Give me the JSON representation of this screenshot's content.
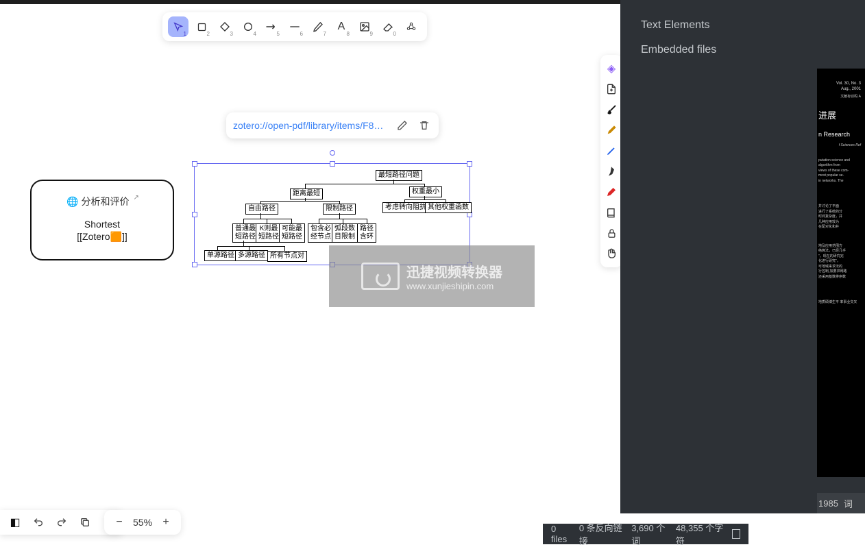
{
  "toolbar": {
    "items": [
      {
        "name": "selection-tool",
        "sub": "1"
      },
      {
        "name": "rectangle-tool",
        "sub": "2"
      },
      {
        "name": "diamond-tool",
        "sub": "3"
      },
      {
        "name": "ellipse-tool",
        "sub": "4"
      },
      {
        "name": "arrow-tool",
        "sub": "5"
      },
      {
        "name": "line-tool",
        "sub": "6"
      },
      {
        "name": "draw-tool",
        "sub": "7"
      },
      {
        "name": "text-tool",
        "sub": "8"
      },
      {
        "name": "image-tool",
        "sub": "9"
      },
      {
        "name": "eraser-tool",
        "sub": "0"
      },
      {
        "name": "shapes-tool",
        "sub": ""
      }
    ]
  },
  "vtoolbar": {
    "items": [
      {
        "name": "obsidian-icon",
        "color": "#8b5cf6"
      },
      {
        "name": "insert-file-icon",
        "color": "#333"
      },
      {
        "name": "brush-icon",
        "color": "#111"
      },
      {
        "name": "highlighter-icon",
        "color": "#ca8a04"
      },
      {
        "name": "pen-icon",
        "color": "#2563eb"
      },
      {
        "name": "nib-icon",
        "color": "#111"
      },
      {
        "name": "marker-icon",
        "color": "#dc2626"
      },
      {
        "name": "book-icon",
        "color": "#333"
      },
      {
        "name": "lock-icon",
        "color": "#333"
      },
      {
        "name": "hand-icon",
        "color": "#333"
      }
    ]
  },
  "link_popup": {
    "url": "zotero://open-pdf/library/items/F8…"
  },
  "card": {
    "title": "分析和评价",
    "line1": "Shortest",
    "line2_pre": "[[Zotero",
    "line2_post": "]]"
  },
  "diagram": {
    "root": "最短路径问题",
    "l2a": "距离最短",
    "l2b": "权重最小",
    "l3a": "自由路径",
    "l3b": "限制路径",
    "l3c": "考虑转向阻抗",
    "l3d": "其他权重函数",
    "l4a": "普通最\n短路径",
    "l4b": "K则最\n短路径",
    "l4c": "可能最\n短路径",
    "l4d": "包含必\n经节点",
    "l4e": "弧段数\n目限制",
    "l4f": "路径\n含环",
    "l5a": "单源路径",
    "l5b": "多源路径",
    "l5c": "所有节点对"
  },
  "watermark": {
    "line1": "迅捷视频转换器",
    "line2": "www.xunjieshipin.com"
  },
  "bottom": {
    "zoom": "55%"
  },
  "sidebar": {
    "item1": "Text Elements",
    "item2": "Embedded files"
  },
  "status": {
    "files": "0 files",
    "backlinks": "0 条反向链接",
    "words": "3,690 个词",
    "chars": "48,355 个字符"
  },
  "pdf": {
    "vol": "Vol. 30, No. 3",
    "date": "Aug., 2001",
    "code": "文献标识码 A",
    "title_cn": "进展",
    "title_en": "n Research",
    "aff": "f Sciences Ref",
    "abs": "putation science and\nalgorithm from\nviews of these com-\nmost popular se-\nin networks. The",
    "p1": "并讨论了平面\n进行了系统的分\n时间复杂度，并\n几种应用较为\n在配对化和并",
    "p2": "地及应用范围方\n络算法，已经几乎\n\"。现在的研究完\n化进行研究\"，\n可地域来求法的\n行控制,加要求网路\n还采用基数排序数",
    "foot": "地质硕博生平 率事业交叉",
    "caption_year": "1985",
    "caption_word": "词"
  }
}
